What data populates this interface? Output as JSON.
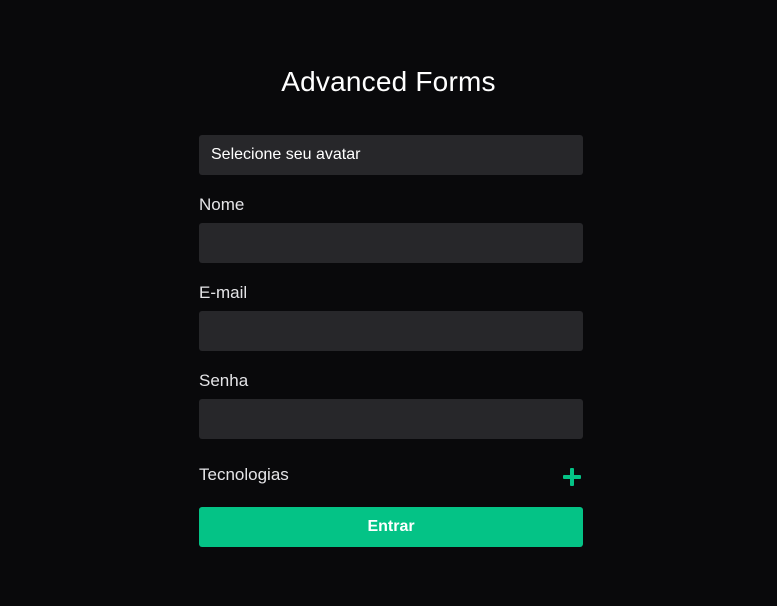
{
  "page": {
    "title": "Advanced Forms"
  },
  "form": {
    "avatar_select": {
      "label": "Selecione seu avatar"
    },
    "fields": [
      {
        "label": "Nome",
        "value": ""
      },
      {
        "label": "E-mail",
        "value": ""
      },
      {
        "label": "Senha",
        "value": ""
      }
    ],
    "technologies": {
      "label": "Tecnologias",
      "add_icon": "plus-icon"
    },
    "submit_label": "Entrar"
  },
  "colors": {
    "background": "#09090b",
    "input_background": "#27272a",
    "accent": "#04c386",
    "text": "#ffffff"
  }
}
